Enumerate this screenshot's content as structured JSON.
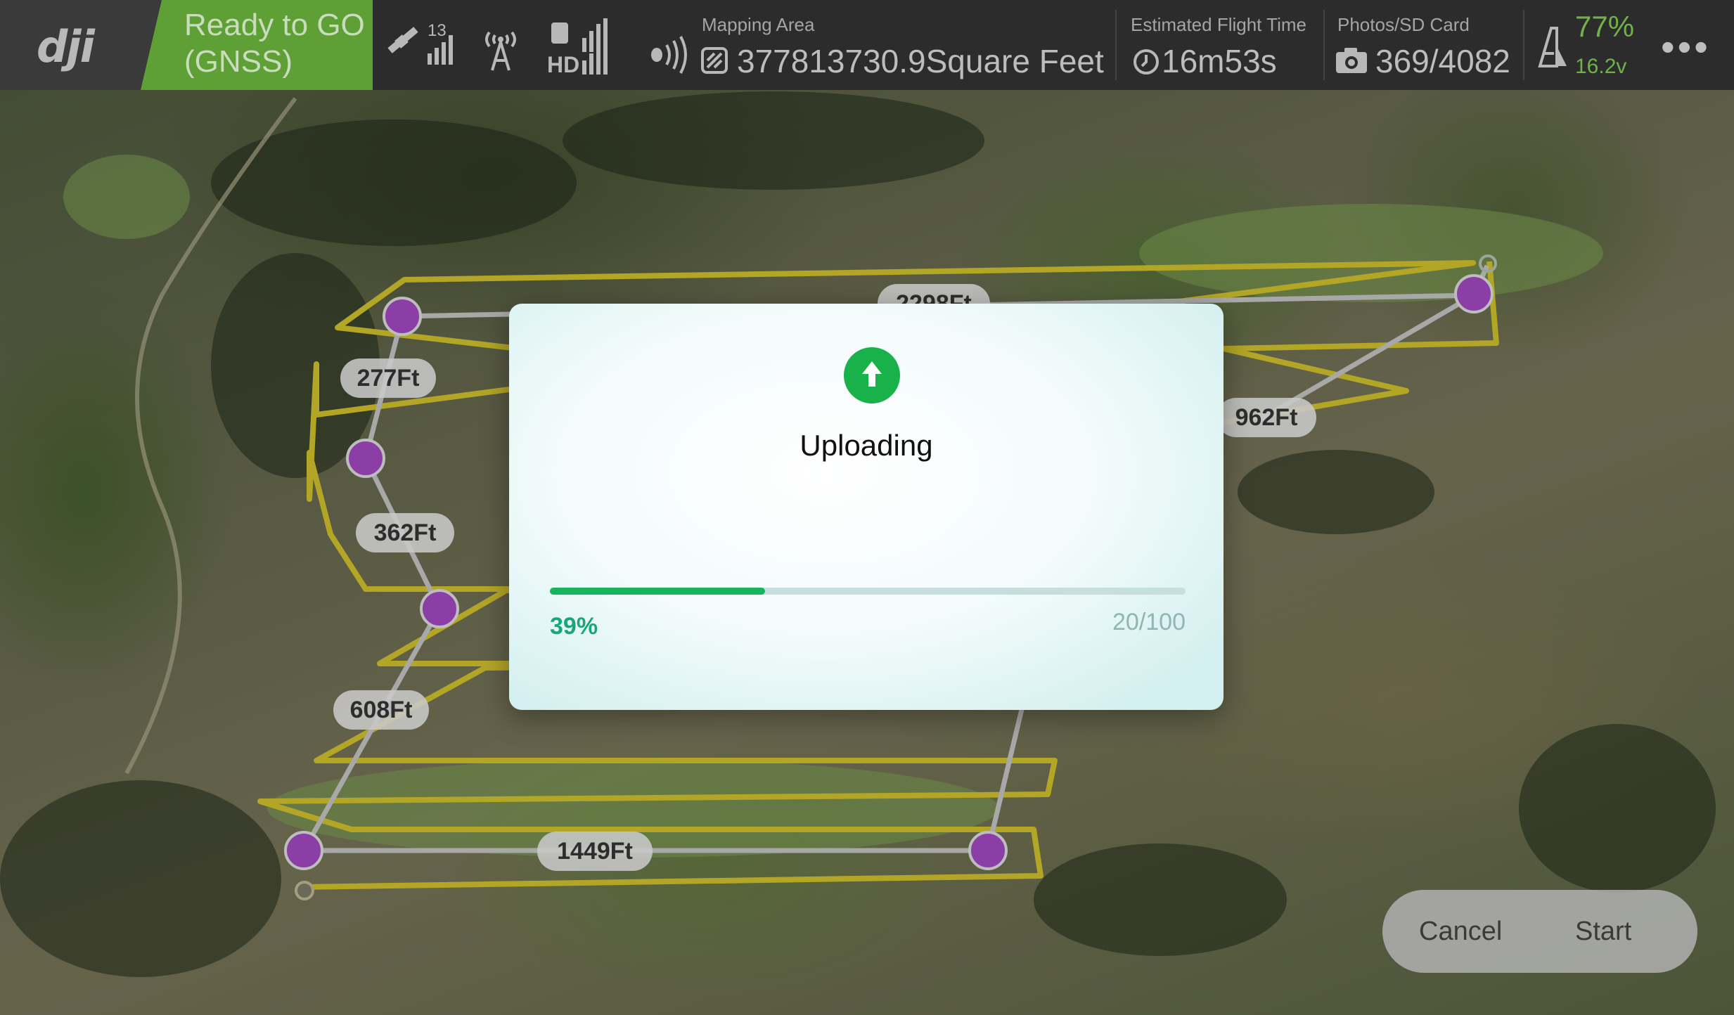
{
  "topbar": {
    "status_line1": "Ready to GO",
    "status_line2": "(GNSS)",
    "satellite_count": "13",
    "hd_label": "HD",
    "mapping_area_caption": "Mapping Area",
    "mapping_area_value": "377813730.9Square Feet",
    "flight_time_caption": "Estimated Flight Time",
    "flight_time_value": "16m53s",
    "photos_caption": "Photos/SD Card",
    "photos_value": "369/4082",
    "battery_percent": "77%",
    "battery_voltage": "16.2v"
  },
  "map": {
    "distance_labels": [
      "277Ft",
      "362Ft",
      "608Ft",
      "1449Ft",
      "962Ft",
      "2298Ft"
    ]
  },
  "dialog": {
    "title": "Uploading",
    "progress_fraction": 0.339,
    "progress_percent_text": "39%",
    "progress_count_text": "20/100"
  },
  "actions": {
    "cancel_label": "Cancel",
    "start_label": "Start"
  },
  "colors": {
    "flight_route": "#b3a526",
    "waypoint": "#8a3ea6",
    "status_ok": "#5fa036",
    "upload_green": "#19b24a"
  }
}
